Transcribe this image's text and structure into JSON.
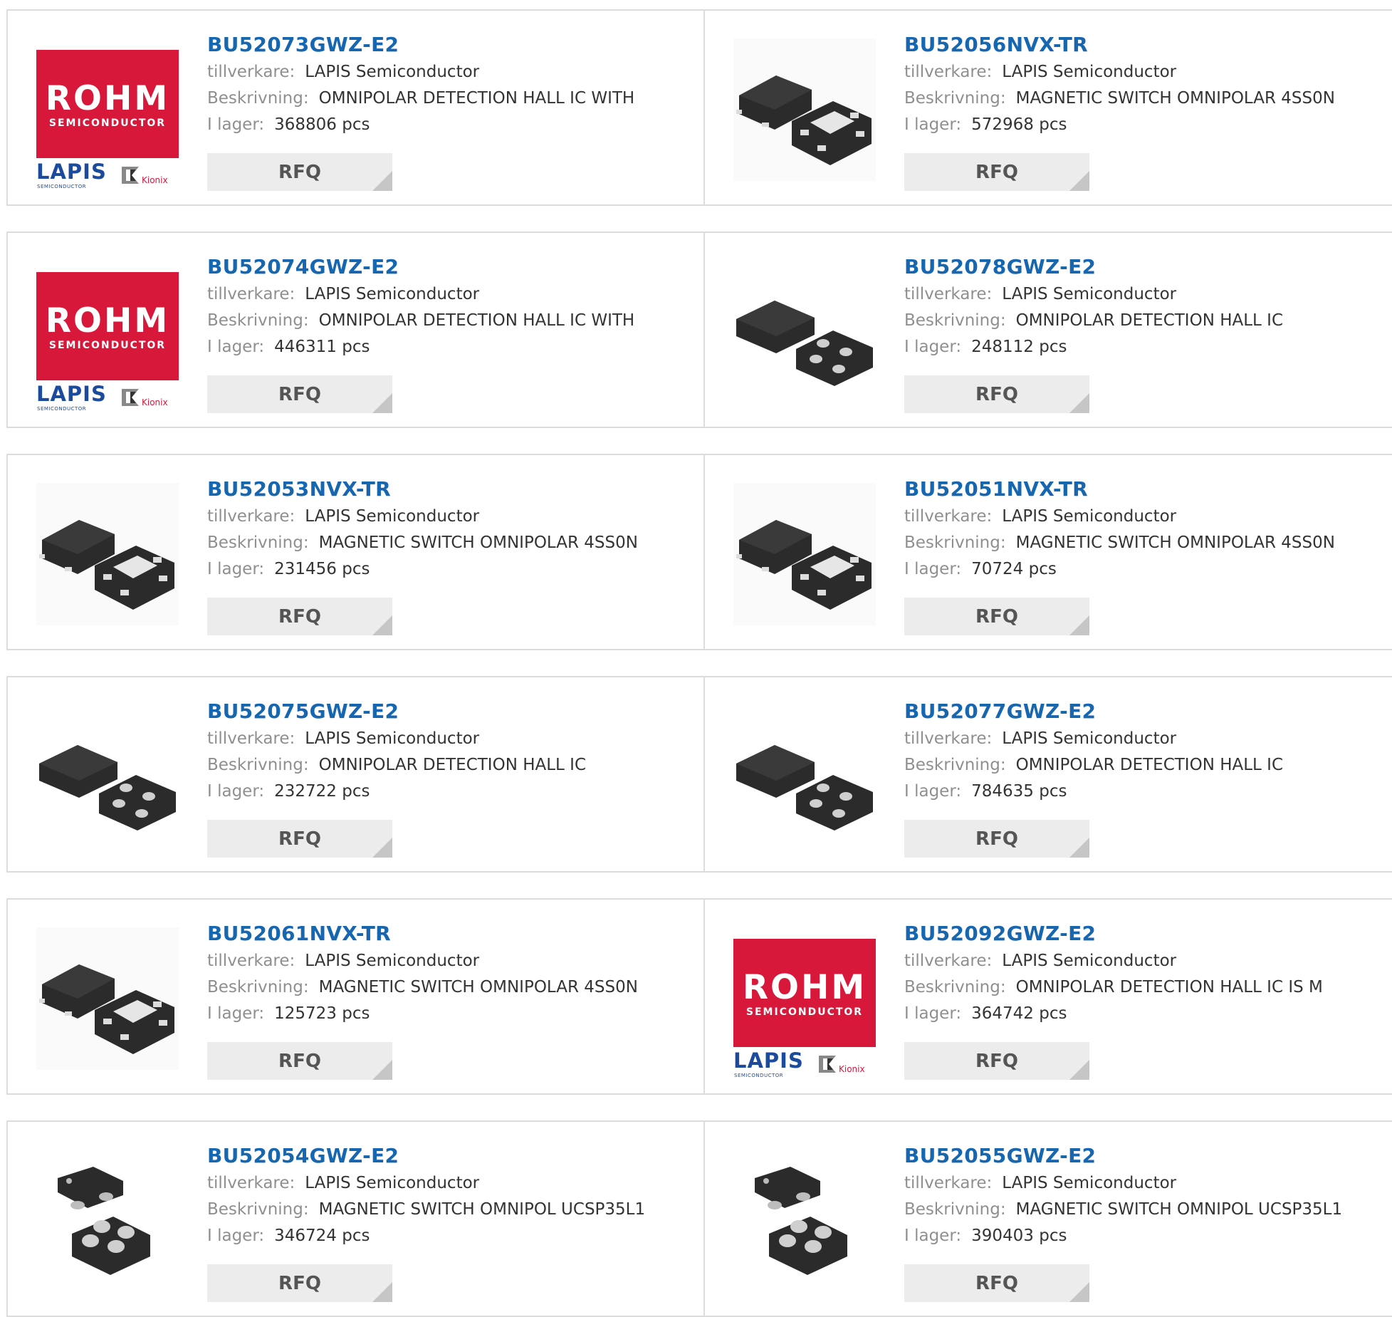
{
  "labels": {
    "manufacturer": "tillverkare:",
    "description": "Beskrivning:",
    "stock": "I lager:",
    "rfq": "RFQ"
  },
  "logo": {
    "brand": "ROHM",
    "brand_sub": "SEMICONDUCTOR",
    "lapis": "LAPIS",
    "lapis_sub": "SEMICONDUCTOR",
    "kionix": "Kionix"
  },
  "colors": {
    "link": "#1766b0",
    "rohm_red": "#d7183a",
    "border": "#dcdcdc",
    "rfq_bg": "#ececec"
  },
  "products": [
    {
      "part": "BU52073GWZ-E2",
      "manufacturer": "LAPIS Semiconductor",
      "description": "OMNIPOLAR DETECTION HALL IC WITH",
      "stock": "368806 pcs",
      "image": "rohm-logo"
    },
    {
      "part": "BU52056NVX-TR",
      "manufacturer": "LAPIS Semiconductor",
      "description": "MAGNETIC SWITCH OMNIPOLAR 4SS0N",
      "stock": "572968 pcs",
      "image": "chip-son"
    },
    {
      "part": "BU52074GWZ-E2",
      "manufacturer": "LAPIS Semiconductor",
      "description": "OMNIPOLAR DETECTION HALL IC WITH",
      "stock": "446311 pcs",
      "image": "rohm-logo"
    },
    {
      "part": "BU52078GWZ-E2",
      "manufacturer": "LAPIS Semiconductor",
      "description": "OMNIPOLAR DETECTION HALL IC",
      "stock": "248112 pcs",
      "image": "chip-bga"
    },
    {
      "part": "BU52053NVX-TR",
      "manufacturer": "LAPIS Semiconductor",
      "description": "MAGNETIC SWITCH OMNIPOLAR 4SS0N",
      "stock": "231456 pcs",
      "image": "chip-son"
    },
    {
      "part": "BU52051NVX-TR",
      "manufacturer": "LAPIS Semiconductor",
      "description": "MAGNETIC SWITCH OMNIPOLAR 4SS0N",
      "stock": "70724 pcs",
      "image": "chip-son"
    },
    {
      "part": "BU52075GWZ-E2",
      "manufacturer": "LAPIS Semiconductor",
      "description": "OMNIPOLAR DETECTION HALL IC",
      "stock": "232722 pcs",
      "image": "chip-bga"
    },
    {
      "part": "BU52077GWZ-E2",
      "manufacturer": "LAPIS Semiconductor",
      "description": "OMNIPOLAR DETECTION HALL IC",
      "stock": "784635 pcs",
      "image": "chip-bga"
    },
    {
      "part": "BU52061NVX-TR",
      "manufacturer": "LAPIS Semiconductor",
      "description": "MAGNETIC SWITCH OMNIPOLAR 4SS0N",
      "stock": "125723 pcs",
      "image": "chip-son"
    },
    {
      "part": "BU52092GWZ-E2",
      "manufacturer": "LAPIS Semiconductor",
      "description": "OMNIPOLAR DETECTION HALL IC IS M",
      "stock": "364742 pcs",
      "image": "rohm-logo"
    },
    {
      "part": "BU52054GWZ-E2",
      "manufacturer": "LAPIS Semiconductor",
      "description": "MAGNETIC SWITCH OMNIPOL UCSP35L1",
      "stock": "346724 pcs",
      "image": "chip-ucsp"
    },
    {
      "part": "BU52055GWZ-E2",
      "manufacturer": "LAPIS Semiconductor",
      "description": "MAGNETIC SWITCH OMNIPOL UCSP35L1",
      "stock": "390403 pcs",
      "image": "chip-ucsp"
    }
  ]
}
